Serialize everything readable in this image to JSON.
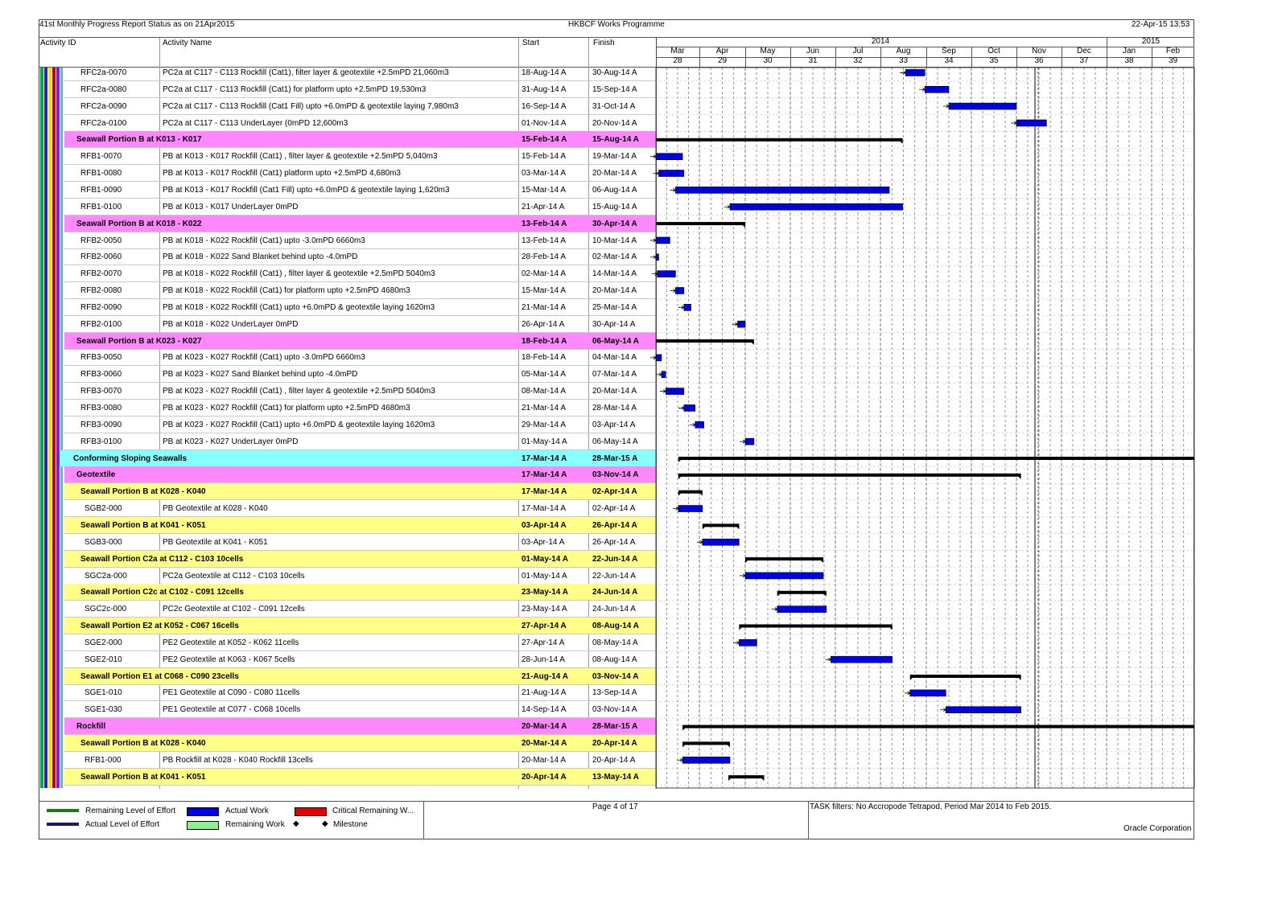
{
  "header": {
    "report_title": "41st Monthly Progress Report Status as on 21Apr2015",
    "programme": "HKBCF Works Programme",
    "datetime": "22-Apr-15 13:53"
  },
  "columns": {
    "activity_id": "Activity ID",
    "activity_name": "Activity Name",
    "start": "Start",
    "finish": "Finish"
  },
  "timeline": {
    "years": [
      "2014",
      "2015"
    ],
    "months": [
      "Mar",
      "Apr",
      "May",
      "Jun",
      "Jul",
      "Aug",
      "Sep",
      "Oct",
      "Nov",
      "Dec",
      "Jan",
      "Feb"
    ],
    "periods": [
      "28",
      "29",
      "30",
      "31",
      "32",
      "33",
      "34",
      "35",
      "36",
      "37",
      "38",
      "39"
    ]
  },
  "rows": [
    {
      "id": "RFC2a-0070",
      "name": "PC2a at C117 - C113 Rockfill (Cat1), filter layer & geotextile +2.5mPD 21,060m3",
      "start": "18-Aug-14 A",
      "finish": "30-Aug-14 A",
      "type": "act"
    },
    {
      "id": "RFC2a-0080",
      "name": "PC2a at C117 - C113 Rockfill (Cat1) for platform upto +2.5mPD 19,530m3",
      "start": "31-Aug-14 A",
      "finish": "15-Sep-14 A",
      "type": "act"
    },
    {
      "id": "RFC2a-0090",
      "name": "PC2a at C117 - C113 Rockfill (Cat1 Fill) upto +6.0mPD & geotextile laying 7,980m3",
      "start": "16-Sep-14 A",
      "finish": "31-Oct-14 A",
      "type": "act"
    },
    {
      "id": "RFC2a-0100",
      "name": "PC2a at C117 - C113 UnderLayer (0mPD 12,600m3",
      "start": "01-Nov-14 A",
      "finish": "20-Nov-14 A",
      "type": "act"
    },
    {
      "id": "",
      "name": "Seawall Portion B at K013 - K017",
      "start": "15-Feb-14 A",
      "finish": "15-Aug-14 A",
      "type": "magenta",
      "label": "Seawall Portion B at K013 - K017"
    },
    {
      "id": "RFB1-0070",
      "name": "PB at K013 - K017 Rockfill (Cat1) , filter layer & geotextile +2.5mPD 5,040m3",
      "start": "15-Feb-14 A",
      "finish": "19-Mar-14 A",
      "type": "act"
    },
    {
      "id": "RFB1-0080",
      "name": "PB at K013 - K017 Rockfill (Cat1) platform upto +2.5mPD 4,680m3",
      "start": "03-Mar-14 A",
      "finish": "20-Mar-14 A",
      "type": "act"
    },
    {
      "id": "RFB1-0090",
      "name": "PB at K013 - K017 Rockfill (Cat1 Fill) upto +6.0mPD & geotextile laying 1,620m3",
      "start": "15-Mar-14 A",
      "finish": "06-Aug-14 A",
      "type": "act"
    },
    {
      "id": "RFB1-0100",
      "name": "PB at K013 - K017 UnderLayer 0mPD",
      "start": "21-Apr-14 A",
      "finish": "15-Aug-14 A",
      "type": "act"
    },
    {
      "id": "",
      "name": "Seawall Portion B at K018 - K022",
      "start": "13-Feb-14 A",
      "finish": "30-Apr-14 A",
      "type": "magenta",
      "label": "Seawall Portion B at K018 - K022"
    },
    {
      "id": "RFB2-0050",
      "name": "PB at K018 - K022 Rockfill (Cat1) upto -3.0mPD 6660m3",
      "start": "13-Feb-14 A",
      "finish": "10-Mar-14 A",
      "type": "act"
    },
    {
      "id": "RFB2-0060",
      "name": "PB at K018 - K022 Sand Blanket behind upto -4.0mPD",
      "start": "28-Feb-14 A",
      "finish": "02-Mar-14 A",
      "type": "act"
    },
    {
      "id": "RFB2-0070",
      "name": "PB at K018 - K022 Rockfill (Cat1) , filter layer & geotextile +2.5mPD 5040m3",
      "start": "02-Mar-14 A",
      "finish": "14-Mar-14 A",
      "type": "act"
    },
    {
      "id": "RFB2-0080",
      "name": "PB at K018 - K022 Rockfill (Cat1) for platform upto +2.5mPD 4680m3",
      "start": "15-Mar-14 A",
      "finish": "20-Mar-14 A",
      "type": "act"
    },
    {
      "id": "RFB2-0090",
      "name": "PB at K018 - K022 Rockfill (Cat1) upto +6.0mPD & geotextile laying 1620m3",
      "start": "21-Mar-14 A",
      "finish": "25-Mar-14 A",
      "type": "act"
    },
    {
      "id": "RFB2-0100",
      "name": "PB at K018 - K022 UnderLayer 0mPD",
      "start": "26-Apr-14 A",
      "finish": "30-Apr-14 A",
      "type": "act"
    },
    {
      "id": "",
      "name": "Seawall Portion B at K023 - K027",
      "start": "18-Feb-14 A",
      "finish": "06-May-14 A",
      "type": "magenta",
      "label": "Seawall Portion B at K023 - K027"
    },
    {
      "id": "RFB3-0050",
      "name": "PB at K023 - K027 Rockfill (Cat1) upto -3.0mPD 6660m3",
      "start": "18-Feb-14 A",
      "finish": "04-Mar-14 A",
      "type": "act"
    },
    {
      "id": "RFB3-0060",
      "name": "PB at K023 - K027 Sand Blanket behind upto -4.0mPD",
      "start": "05-Mar-14 A",
      "finish": "07-Mar-14 A",
      "type": "act"
    },
    {
      "id": "RFB3-0070",
      "name": "PB at K023 - K027 Rockfill (Cat1) , filter layer & geotextile +2.5mPD 5040m3",
      "start": "08-Mar-14 A",
      "finish": "20-Mar-14 A",
      "type": "act"
    },
    {
      "id": "RFB3-0080",
      "name": "PB at K023 - K027 Rockfill (Cat1) for platform upto +2.5mPD 4680m3",
      "start": "21-Mar-14 A",
      "finish": "28-Mar-14 A",
      "type": "act"
    },
    {
      "id": "RFB3-0090",
      "name": "PB at K023 - K027 Rockfill (Cat1) upto +6.0mPD & geotextile laying 1620m3",
      "start": "29-Mar-14 A",
      "finish": "03-Apr-14 A",
      "type": "act"
    },
    {
      "id": "RFB3-0100",
      "name": "PB at K023 - K027 UnderLayer 0mPD",
      "start": "01-May-14 A",
      "finish": "06-May-14 A",
      "type": "act"
    },
    {
      "id": "",
      "name": "Conforming Sloping Seawalls",
      "start": "17-Mar-14 A",
      "finish": "28-Mar-15 A",
      "type": "cyan",
      "label": "Conforming Sloping Seawalls"
    },
    {
      "id": "",
      "name": "Geotextile",
      "start": "17-Mar-14 A",
      "finish": "03-Nov-14 A",
      "type": "magenta",
      "label": "Geotextile"
    },
    {
      "id": "",
      "name": "Seawall Portion B at K028 - K040",
      "start": "17-Mar-14 A",
      "finish": "02-Apr-14 A",
      "type": "yellow",
      "label": "Seawall Portion B at K028 - K040"
    },
    {
      "id": "SGB2-000",
      "name": "PB Geotextile at K028 - K040",
      "start": "17-Mar-14 A",
      "finish": "02-Apr-14 A",
      "type": "act2"
    },
    {
      "id": "",
      "name": "Seawall Portion B at K041 - K051",
      "start": "03-Apr-14 A",
      "finish": "26-Apr-14 A",
      "type": "yellow",
      "label": "Seawall Portion B at K041 - K051"
    },
    {
      "id": "SGB3-000",
      "name": "PB Geotextile at K041 - K051",
      "start": "03-Apr-14 A",
      "finish": "26-Apr-14 A",
      "type": "act2"
    },
    {
      "id": "",
      "name": "Seawall Portion C2a at C112 - C103 10cells",
      "start": "01-May-14 A",
      "finish": "22-Jun-14 A",
      "type": "yellow",
      "label": "Seawall Portion C2a at C112 - C103 10cells"
    },
    {
      "id": "SGC2a-000",
      "name": "PC2a Geotextile at C112 - C103 10cells",
      "start": "01-May-14 A",
      "finish": "22-Jun-14 A",
      "type": "act2"
    },
    {
      "id": "",
      "name": "Seawall Portion C2c at C102 - C091 12cells",
      "start": "23-May-14 A",
      "finish": "24-Jun-14 A",
      "type": "yellow",
      "label": "Seawall Portion C2c at C102 - C091 12cells"
    },
    {
      "id": "SGC2c-000",
      "name": "PC2c Geotextile at C102 - C091 12cells",
      "start": "23-May-14 A",
      "finish": "24-Jun-14 A",
      "type": "act2"
    },
    {
      "id": "",
      "name": "Seawall Portion E2 at K052 - C067 16cells",
      "start": "27-Apr-14 A",
      "finish": "08-Aug-14 A",
      "type": "yellow",
      "label": "Seawall Portion E2 at K052 - C067 16cells"
    },
    {
      "id": "SGE2-000",
      "name": "PE2 Geotextile at K052 - K062 11cells",
      "start": "27-Apr-14 A",
      "finish": "08-May-14 A",
      "type": "act2"
    },
    {
      "id": "SGE2-010",
      "name": "PE2 Geotextile at K063 - K067 5cells",
      "start": "28-Jun-14 A",
      "finish": "08-Aug-14 A",
      "type": "act2"
    },
    {
      "id": "",
      "name": "Seawall Portion E1 at C068 - C090 23cells",
      "start": "21-Aug-14 A",
      "finish": "03-Nov-14 A",
      "type": "yellow",
      "label": "Seawall Portion E1 at C068 - C090 23cells"
    },
    {
      "id": "SGE1-010",
      "name": "PE1 Geotextile at C090 - C080 11cells",
      "start": "21-Aug-14 A",
      "finish": "13-Sep-14 A",
      "type": "act2"
    },
    {
      "id": "SGE1-030",
      "name": "PE1 Geotextile at C077 - C068 10cells",
      "start": "14-Sep-14 A",
      "finish": "03-Nov-14 A",
      "type": "act2"
    },
    {
      "id": "",
      "name": "Rockfill",
      "start": "20-Mar-14 A",
      "finish": "28-Mar-15 A",
      "type": "magenta",
      "label": "Rockfill"
    },
    {
      "id": "",
      "name": "Seawall Portion B at K028 - K040",
      "start": "20-Mar-14 A",
      "finish": "20-Apr-14 A",
      "type": "yellow",
      "label": "Seawall Portion B at K028 - K040"
    },
    {
      "id": "RFB1-000",
      "name": "PB Rockfill at K028 - K040 Rockfill 13cells",
      "start": "20-Mar-14 A",
      "finish": "20-Apr-14 A",
      "type": "act2"
    },
    {
      "id": "",
      "name": "Seawall Portion B at K041 - K051",
      "start": "20-Apr-14 A",
      "finish": "13-May-14 A",
      "type": "yellow",
      "label": "Seawall Portion B at K041 - K051"
    }
  ],
  "legend": {
    "remaining_loe": "Remaining Level of Effort",
    "actual_loe": "Actual Level of Effort",
    "actual_work": "Actual Work",
    "remaining_work": "Remaining Work",
    "critical_remaining": "Critical Remaining W...",
    "milestone": "Milestone",
    "colors": {
      "remaining_loe": "#1a7a1a",
      "actual_loe": "#1a1a6a",
      "actual_work": "#0000e0",
      "remaining_work": "#90ee90",
      "critical_remaining": "#e00000"
    }
  },
  "footer": {
    "page": "Page 4 of 17",
    "filters": "TASK filters: No Accropode Tetrapod, Period Mar 2014 to Feb 2015.",
    "company": "Oracle Corporation"
  },
  "colors": {
    "magenta_band": "#ff88ff",
    "cyan_band": "#88ffff",
    "yellow_band": "#ffff88",
    "bar_blue": "#0000e0",
    "summary_black": "#000000"
  }
}
